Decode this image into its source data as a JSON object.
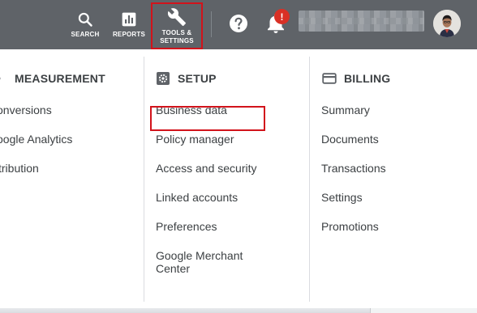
{
  "topbar": {
    "search_label": "SEARCH",
    "reports_label": "REPORTS",
    "tools_label_line1": "TOOLS &",
    "tools_label_line2": "SETTINGS",
    "alert_badge": "!"
  },
  "columns": {
    "measurement": {
      "title": "MEASUREMENT",
      "items": [
        "onversions",
        "oogle Analytics",
        "tribution"
      ]
    },
    "setup": {
      "title": "SETUP",
      "items": [
        "Business data",
        "Policy manager",
        "Access and security",
        "Linked accounts",
        "Preferences",
        "Google Merchant Center"
      ]
    },
    "billing": {
      "title": "BILLING",
      "items": [
        "Summary",
        "Documents",
        "Transactions",
        "Settings",
        "Promotions"
      ]
    }
  },
  "colors": {
    "topbar": "#5f6368",
    "highlight": "#d2131b",
    "alert": "#d93025",
    "text": "#3c4043"
  }
}
